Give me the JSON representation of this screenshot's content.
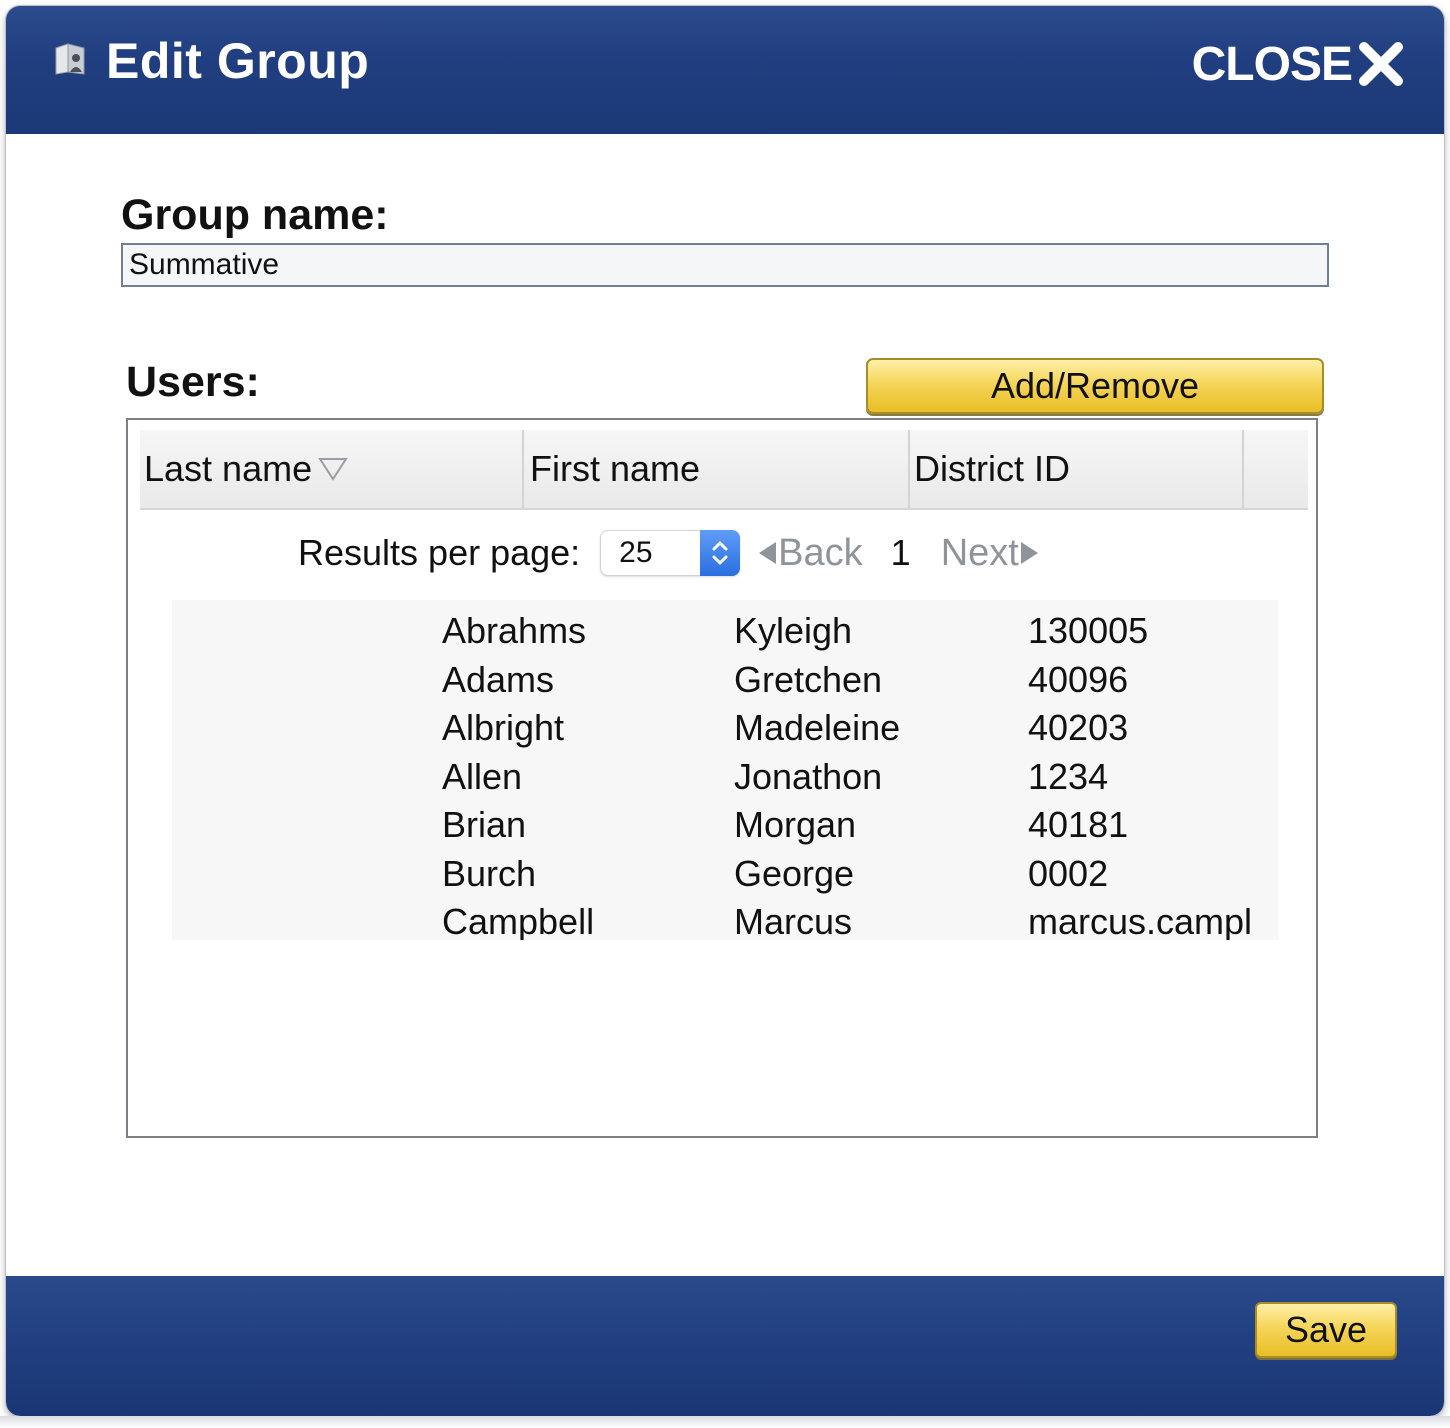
{
  "dialog": {
    "title": "Edit Group",
    "close_label": "CLOSE"
  },
  "group": {
    "label": "Group name:",
    "value": "Summative"
  },
  "users": {
    "label": "Users:",
    "add_remove_label": "Add/Remove",
    "columns": [
      "Last name",
      "First name",
      "District ID"
    ],
    "sort_column": "Last name",
    "pager": {
      "results_label": "Results per page:",
      "results_value": "25",
      "back_label": "Back",
      "page": "1",
      "next_label": "Next"
    },
    "rows": [
      {
        "last": "Abrahms",
        "first": "Kyleigh",
        "district_id": "130005"
      },
      {
        "last": "Adams",
        "first": "Gretchen",
        "district_id": "40096"
      },
      {
        "last": "Albright",
        "first": "Madeleine",
        "district_id": "40203"
      },
      {
        "last": "Allen",
        "first": "Jonathon",
        "district_id": "1234"
      },
      {
        "last": "Brian",
        "first": "Morgan",
        "district_id": "40181"
      },
      {
        "last": "Burch",
        "first": "George",
        "district_id": "0002"
      },
      {
        "last": "Campbell",
        "first": "Marcus",
        "district_id": "marcus.campl"
      }
    ]
  },
  "footer": {
    "save_label": "Save"
  },
  "colors": {
    "titlebar": "#213f80",
    "button_gold": "#f5d55a",
    "pager_disabled": "#8f949b",
    "select_accent": "#2a6fe0"
  },
  "icons": {
    "title": "group-folder-icon",
    "close": "close-x-icon",
    "sort": "sort-descending-icon",
    "select": "select-updown-icon",
    "back": "triangle-left-icon",
    "next": "triangle-right-icon"
  }
}
